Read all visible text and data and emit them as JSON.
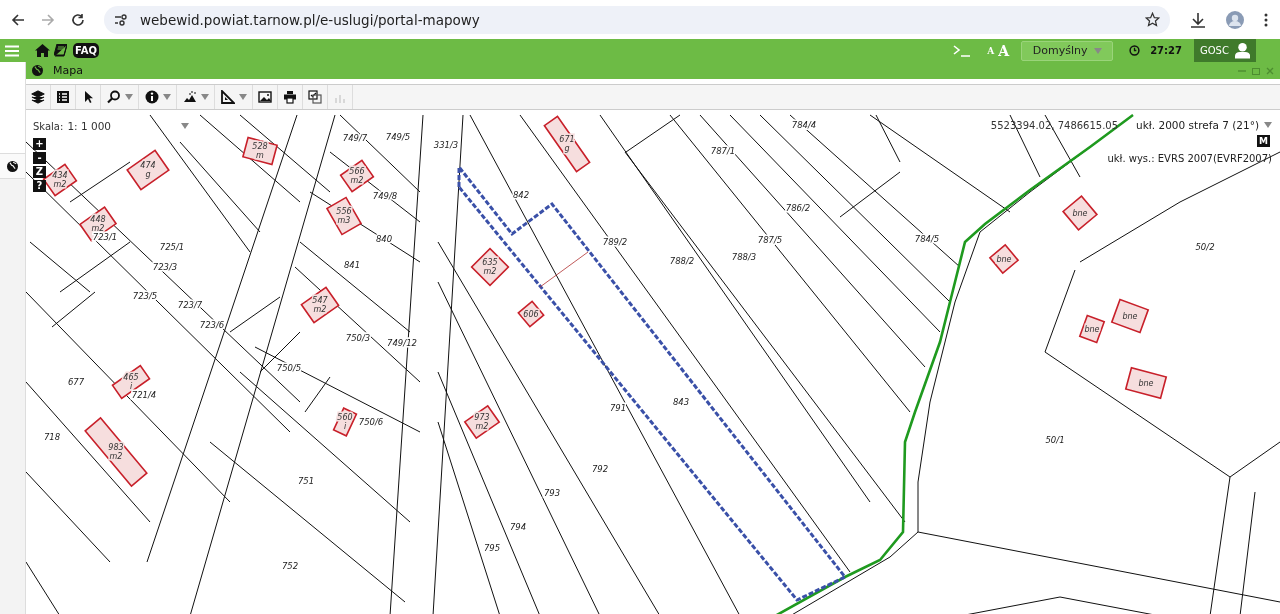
{
  "browser": {
    "url": "webewid.powiat.tarnow.pl/e-uslugi/portal-mapowy"
  },
  "header": {
    "faq": "FAQ",
    "font_sizes": [
      "A",
      "A"
    ],
    "profile": "Domyślny",
    "timer": "27:27",
    "user": "GOSC"
  },
  "window": {
    "title": "Mapa"
  },
  "toolbar": {
    "tools": [
      {
        "kind": "button",
        "disabled": false
      },
      {
        "kind": "button",
        "disabled": false
      },
      {
        "kind": "button",
        "disabled": false
      },
      {
        "kind": "menu",
        "disabled": false
      },
      {
        "kind": "menu",
        "disabled": false
      },
      {
        "kind": "menu",
        "disabled": false
      },
      {
        "kind": "menu",
        "disabled": false
      },
      {
        "kind": "button",
        "disabled": false
      },
      {
        "kind": "button",
        "disabled": false
      },
      {
        "kind": "button",
        "disabled": false
      },
      {
        "kind": "button",
        "disabled": true
      }
    ]
  },
  "map": {
    "scale_label": "Skala:",
    "scale": "1: 1 000",
    "zoom_controls": [
      "+",
      "-",
      "Z",
      "?"
    ],
    "coordinates": "5523394.02, 7486615.05",
    "crs": "ukł. 2000 strefa 7 (21°)",
    "mode_badge": "M",
    "height_system": "ukł. wys.: EVRS 2007(EVRF2007)",
    "parcels": [
      "723/1",
      "725/1",
      "723/3",
      "723/5",
      "723/7",
      "723/6",
      "749/7",
      "749/5",
      "331/3",
      "749/8",
      "840",
      "841",
      "842",
      "789/2",
      "788/2",
      "788/3",
      "787/5",
      "787/1",
      "786/2",
      "784/4",
      "784/5",
      "50/2",
      "50/1",
      "750/3",
      "749/12",
      "750/5",
      "750/6",
      "677",
      "721/4",
      "718",
      "751",
      "752",
      "791",
      "843",
      "792",
      "793",
      "794",
      "795"
    ],
    "buildings": [
      {
        "number": "474",
        "use": "g"
      },
      {
        "number": "547",
        "use": "m2"
      },
      {
        "number": "671",
        "use": "g"
      },
      {
        "number": "635",
        "use": "m2"
      },
      {
        "number": "973",
        "use": "m2"
      },
      {
        "number": "465",
        "use": "i"
      },
      {
        "number": "983",
        "use": "m2"
      },
      {
        "number": "556",
        "use": "m3"
      },
      {
        "number": "528",
        "use": "m"
      },
      {
        "number": "566",
        "use": "m2"
      },
      {
        "number": "448",
        "use": "m2"
      },
      {
        "number": "434",
        "use": "m2"
      },
      {
        "number": "606"
      },
      {
        "number": "560",
        "use": "i"
      },
      {
        "number": "bne"
      },
      {
        "number": "bne"
      },
      {
        "number": "bne"
      },
      {
        "number": "bne"
      },
      {
        "number": "bne"
      }
    ]
  }
}
